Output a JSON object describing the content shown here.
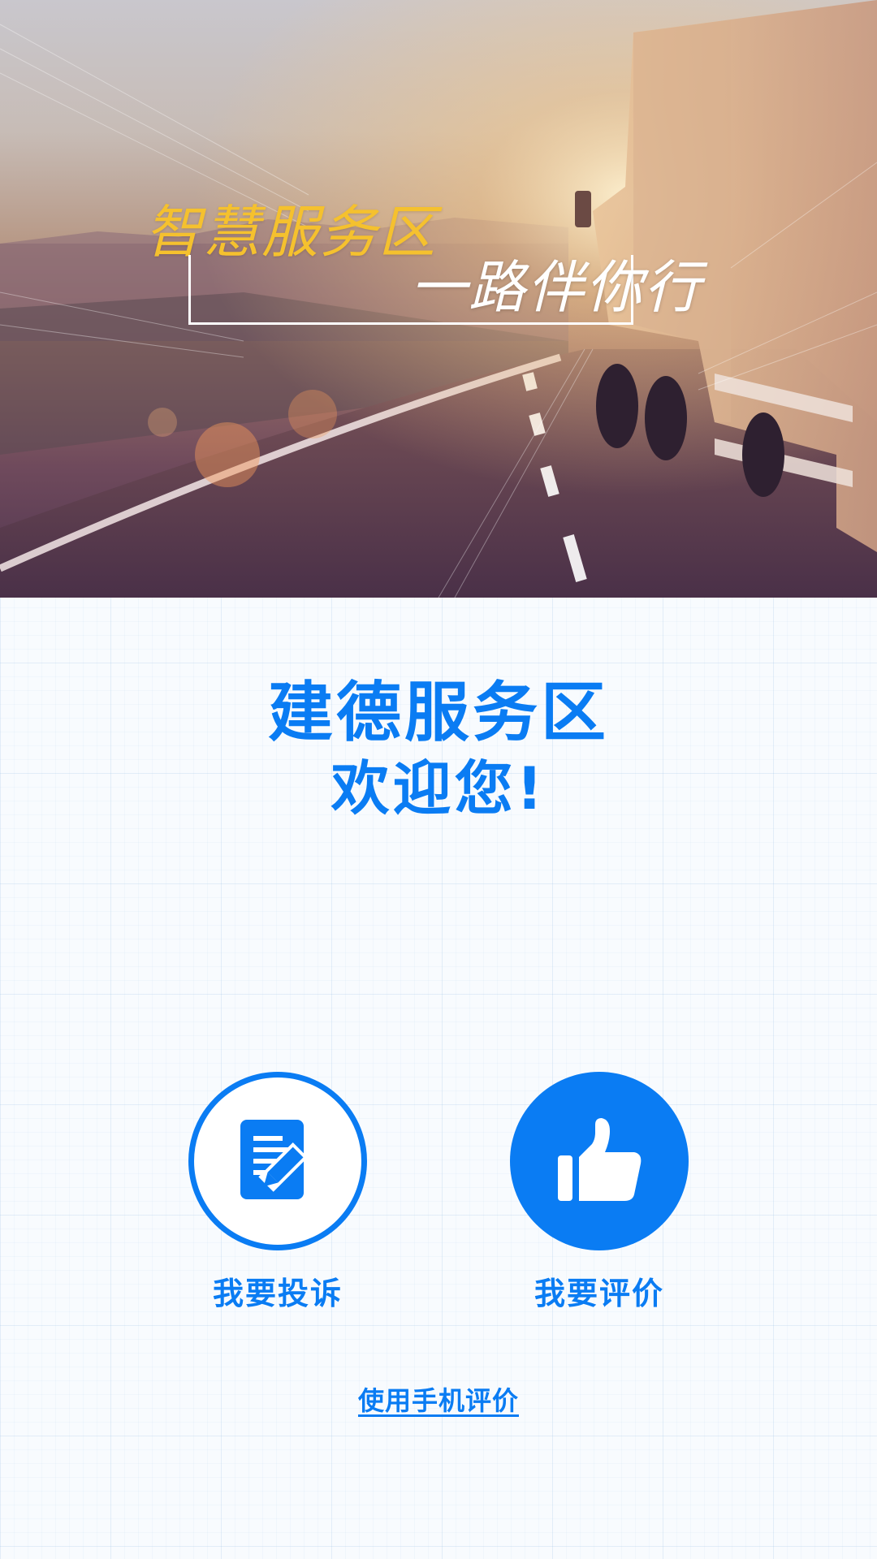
{
  "hero": {
    "slogan_primary": "智慧服务区",
    "slogan_secondary": "一路伴你行",
    "image": "highway-truck-sunset"
  },
  "welcome": {
    "title": "建德服务区",
    "subtitle": "欢迎您!"
  },
  "actions": {
    "complain": {
      "label": "我要投诉",
      "icon": "document-edit-icon"
    },
    "rate": {
      "label": "我要评价",
      "icon": "thumbs-up-icon"
    }
  },
  "mobile_link": {
    "label": "使用手机评价"
  },
  "colors": {
    "accent": "#0a7cf3",
    "slogan_yellow": "#f5c12e",
    "background": "#f8fbfe"
  }
}
